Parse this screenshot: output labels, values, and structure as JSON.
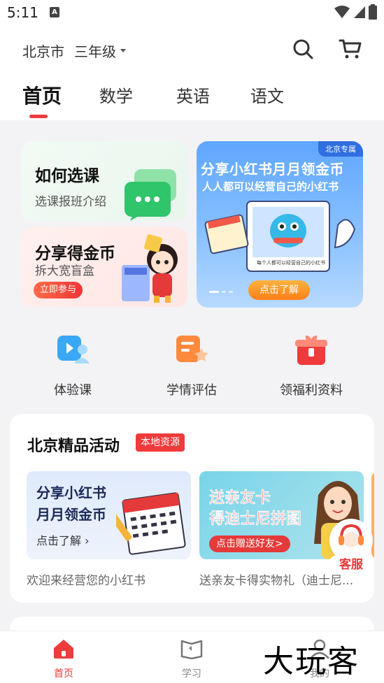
{
  "status_bar": {
    "time": "5:11",
    "indicator": "A"
  },
  "header": {
    "city": "北京市",
    "grade": "三年级",
    "icons": [
      "search-icon",
      "cart-icon"
    ]
  },
  "tabs": [
    {
      "label": "首页",
      "active": true
    },
    {
      "label": "数学",
      "active": false
    },
    {
      "label": "英语",
      "active": false
    },
    {
      "label": "语文",
      "active": false
    }
  ],
  "promo_cards": {
    "choose_course": {
      "title": "如何选课",
      "subtitle": "选课报班介绍"
    },
    "share_coins": {
      "title": "分享得金币",
      "subtitle": "拆大宽盲盒",
      "button": "立即参与"
    }
  },
  "banner": {
    "tag": "北京专属",
    "title": "分享小红书月月领金币",
    "subtitle": "人人都可以经营自己的小红书",
    "button": "点击了解",
    "slide_count": 3,
    "active_slide": 1
  },
  "quick_links": [
    {
      "label": "体验课",
      "icon": "trial-class-icon",
      "color": "#3aa8f5"
    },
    {
      "label": "学情评估",
      "icon": "assessment-icon",
      "color": "#ff8a3d"
    },
    {
      "label": "领福利资料",
      "icon": "gift-icon",
      "color": "#ef3b3b"
    }
  ],
  "activities": {
    "title": "北京精品活动",
    "badge": "本地资源",
    "items": [
      {
        "card_title_line1": "分享小红书",
        "card_title_line2": "月月领金币",
        "card_link": "点击了解",
        "caption": "欢迎来经营您的小红书"
      },
      {
        "card_title_line1": "送亲友卡",
        "card_title_line2": "得迪士尼拼图",
        "card_button": "点击赠送好友>",
        "caption": "送亲友卡得实物礼（迪士尼..."
      }
    ]
  },
  "service": {
    "label": "客服"
  },
  "bottom_nav": [
    {
      "label": "首页",
      "icon": "home-icon",
      "active": true
    },
    {
      "label": "学习",
      "icon": "study-book-icon",
      "active": false
    },
    {
      "label": "我的",
      "icon": "profile-icon",
      "active": false
    }
  ],
  "watermark": "大玩客",
  "colors": {
    "accent": "#ef3b3b",
    "banner_blue": "#5fa6ff",
    "green": "#2fc56a"
  }
}
